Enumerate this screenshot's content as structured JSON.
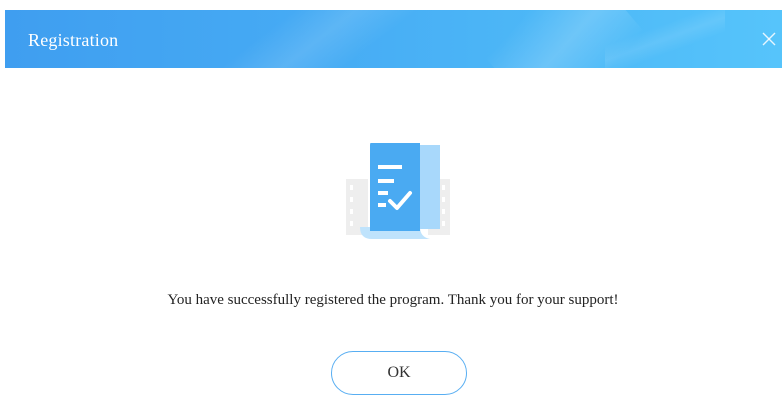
{
  "dialog": {
    "title": "Registration",
    "close_icon": "close-icon",
    "illustration_icon": "registration-document-check-icon",
    "message": "You have successfully registered the program. Thank you for your support!",
    "ok_label": "OK"
  },
  "colors": {
    "titlebar_start": "#3f9ef0",
    "titlebar_end": "#56c4fb",
    "button_border": "#58aef2",
    "document_blue": "#4aaaf2",
    "document_light_blue": "#a8d8fb"
  }
}
